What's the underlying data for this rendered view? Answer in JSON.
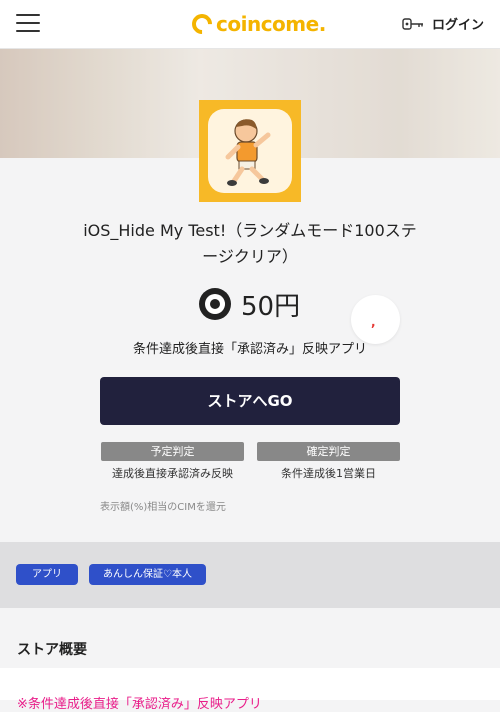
{
  "header": {
    "logo_text": "coincome.",
    "login_label": "ログイン"
  },
  "offer": {
    "title": "iOS_Hide My Test!（ランダムモード100ステージクリア）",
    "reward_amount": "50円",
    "condition": "条件達成後直接「承認済み」反映アプリ",
    "store_button": "ストアへGO",
    "bubble_mark": ",",
    "judgments": [
      {
        "tag": "予定判定",
        "desc": "達成後直接承認済み反映"
      },
      {
        "tag": "確定判定",
        "desc": "条件達成後1営業日"
      }
    ],
    "note": "表示額(%)相当のCIMを還元"
  },
  "tags": [
    "アプリ",
    "あんしん保証♡本人"
  ],
  "section": {
    "title": "ストア概要",
    "summary_text": "※条件達成後直接「承認済み」反映アプリ"
  },
  "colors": {
    "brand": "#f4b400",
    "button": "#21213d",
    "tag_blue": "#2f50c9",
    "accent_pink": "#e91e8a"
  },
  "icons": {
    "menu": "hamburger-icon",
    "login": "key-icon",
    "coin": "coin-icon"
  }
}
